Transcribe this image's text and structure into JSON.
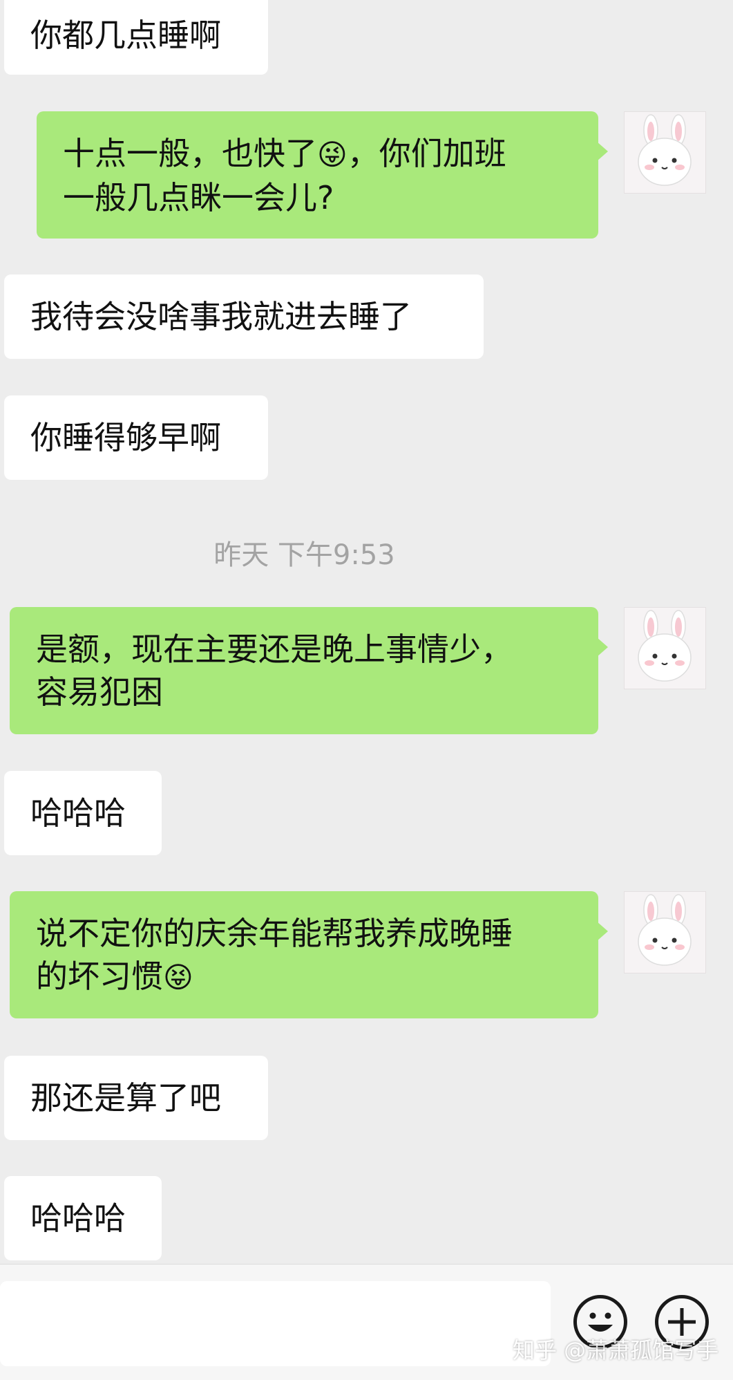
{
  "messages": [
    {
      "side": "left",
      "text": "你都几点睡啊"
    },
    {
      "side": "right",
      "line1": "十点一般，也快了",
      "emoji": "😜",
      "line1b": "，你们加班",
      "line2": "一般几点眯一会儿?"
    },
    {
      "side": "left",
      "text": "我待会没啥事我就进去睡了"
    },
    {
      "side": "left",
      "text": "你睡得够早啊"
    },
    {
      "side": "right",
      "line1": "是额，现在主要还是晚上事情少，",
      "line2": "容易犯困"
    },
    {
      "side": "left",
      "text": "哈哈哈"
    },
    {
      "side": "right",
      "line1": "说不定你的庆余年能帮我养成晚睡",
      "line2": "的坏习惯",
      "emoji": "😝"
    },
    {
      "side": "left",
      "text": "那还是算了吧"
    },
    {
      "side": "left",
      "text": "哈哈哈"
    }
  ],
  "timestamp": "昨天 下午9:53",
  "watermark": "知乎 @萧萧孤馆写手",
  "input_bar": {
    "emoji_icon": "smiley-face-icon",
    "plus_icon": "plus-icon"
  },
  "colors": {
    "background": "#ededed",
    "self_bubble": "#a9e97b",
    "other_bubble": "#ffffff",
    "timestamp": "#a3a3a3"
  }
}
